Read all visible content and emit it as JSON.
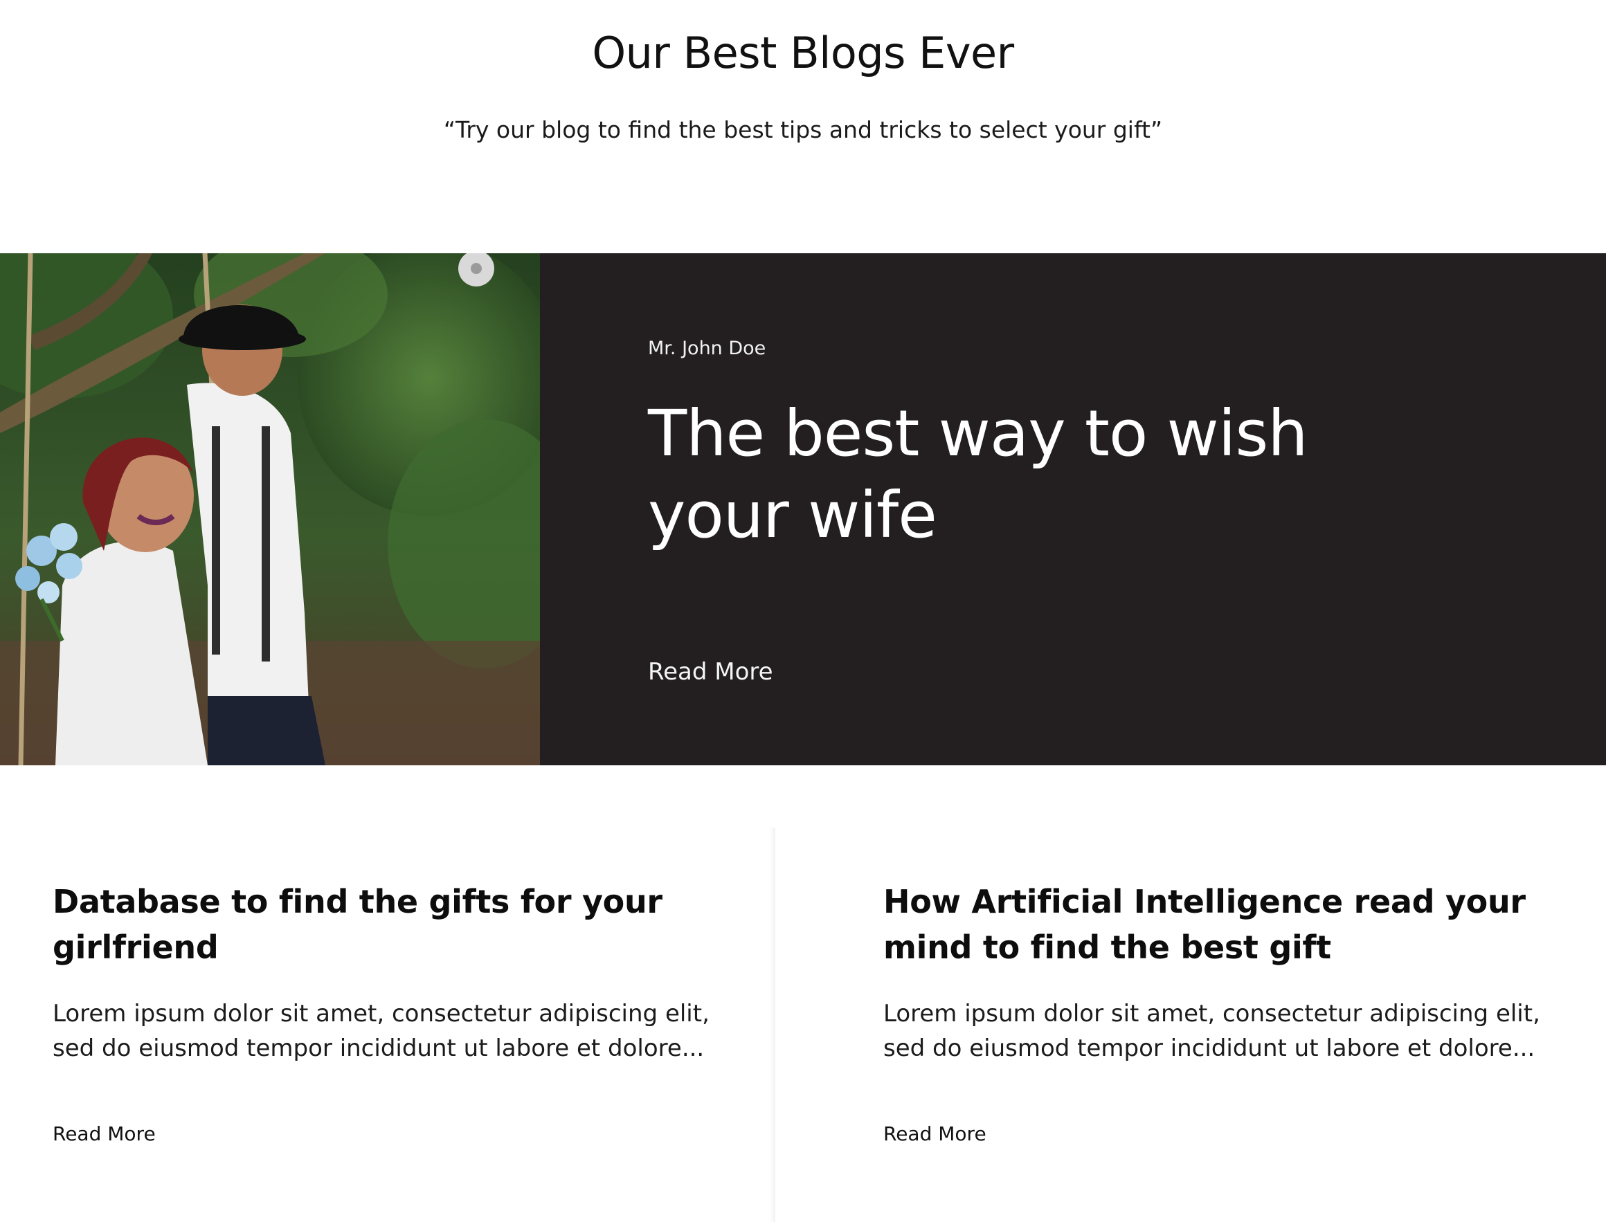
{
  "header": {
    "title": "Our Best Blogs Ever",
    "subtitle": "“Try our blog to find the best tips and tricks to select your gift”"
  },
  "featured": {
    "author": "Mr. John Doe",
    "title": "The best way to wish your wife",
    "read_more": "Read More",
    "panel_color": "#231f20"
  },
  "posts": [
    {
      "title": "Database to find the gifts for your girlfriend",
      "excerpt": "Lorem ipsum dolor sit amet, consectetur adipiscing elit, sed do eiusmod tempor incididunt ut labore et dolore...",
      "read_more": "Read More"
    },
    {
      "title": "How Artificial Intelligence read your mind to find the best gift",
      "excerpt": "Lorem ipsum dolor sit amet, consectetur adipiscing elit, sed do eiusmod tempor incididunt ut labore et dolore...",
      "read_more": "Read More"
    }
  ]
}
